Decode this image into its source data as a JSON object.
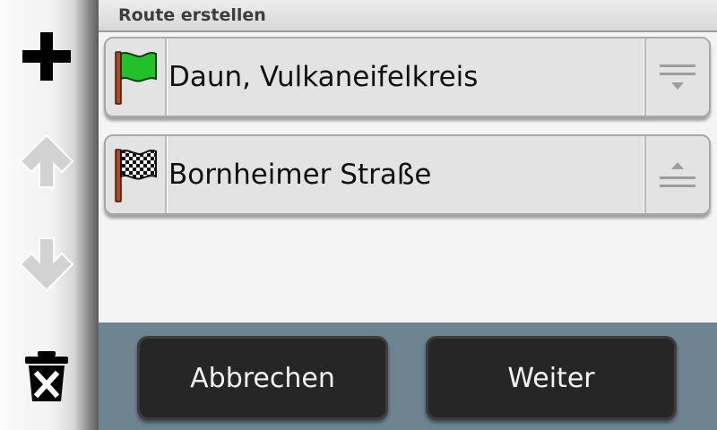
{
  "header": {
    "title": "Route erstellen"
  },
  "toolbar": {
    "add_icon": "plus-icon",
    "move_up_icon": "arrow-up-icon",
    "move_down_icon": "arrow-down-icon",
    "delete_icon": "trash-icon"
  },
  "route": {
    "stops": [
      {
        "label": "Daun, Vulkaneifelkreis",
        "icon": "green-flag-icon",
        "handle_icon": "move-down-handle-icon"
      },
      {
        "label": "Bornheimer Straße",
        "icon": "checkered-flag-icon",
        "handle_icon": "move-up-handle-icon"
      }
    ]
  },
  "actions": {
    "cancel_label": "Abbrechen",
    "next_label": "Weiter"
  },
  "colors": {
    "bottom_bar": "#6f8491",
    "button_bg": "#262626",
    "start_flag": "#22c12a",
    "pole": "#b5461e"
  }
}
